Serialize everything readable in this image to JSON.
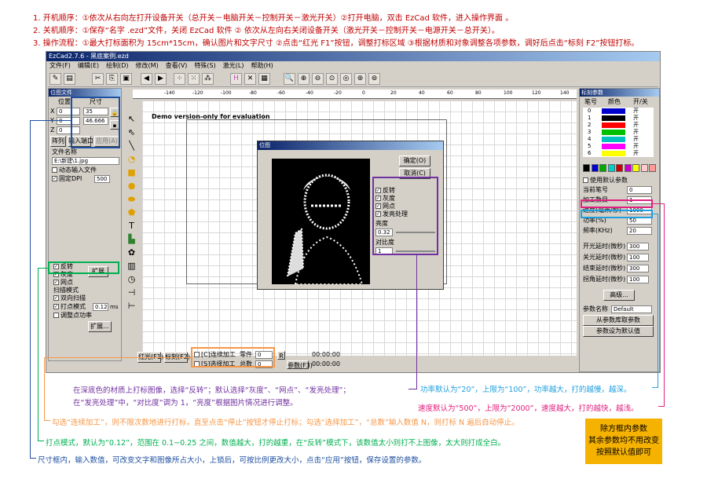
{
  "instructions": [
    "1. 开机顺序：①依次从右向左打开设备开关（总开关－电脑开关－控制开关－激光开关）②打开电脑，双击 EzCad 软件，进入操作界面 。",
    "2. 关机顺序：①保存“名字 .ezd”文件，关闭 EzCad 软件 ② 依次从左向右关闭设备开关（激光开关－控制开关－电源开关－总开关）。",
    "3. 操作流程：①最大打标面积为 15cm*15cm，确认图片和文字尺寸 ②点击“红光 F1”按钮，调整打标区域 ③根据材质和对象调整各项参数，调好后点击“标刻 F2”按钮打标。"
  ],
  "window": {
    "title": "EzCad2.7.6 - 黑底案例.ezd",
    "menus": [
      "文件(F)",
      "编辑(E)",
      "绘制(D)",
      "修改(M)",
      "查看(V)",
      "特殊(S)",
      "激光(L)",
      "帮助(H)"
    ]
  },
  "toolbar": {
    "icons": [
      "open-icon",
      "save-icon",
      "cut-icon",
      "copy-icon",
      "paste-icon",
      "zoom-in-icon",
      "zoom-out-icon"
    ]
  },
  "position_panel": {
    "title": "位图文件",
    "pos_header": "位置",
    "size_header": "尺寸",
    "x_label": "X",
    "y_label": "Y",
    "z_label": "Z",
    "x_value": "0",
    "y_value": "0",
    "z_value": "0",
    "w_value": "35",
    "h_value": "46.666",
    "tabs": [
      "阵列",
      "输入端口",
      "应用(A)"
    ]
  },
  "file_panel": {
    "name_label": "文件名称",
    "path": "E:\\新建\\1.jpg",
    "dynamic_input": "动态输入文件",
    "fixed_dpi": "固定DPI",
    "dpi_value": "500",
    "invert": "反转",
    "gray": "灰度",
    "dither": "网点",
    "expand_button": "扩展",
    "scan_mode": "扫描模式",
    "bidir": "双向扫描",
    "dot_mode": "打点模式",
    "dot_value": "0.12",
    "dot_unit": "ms",
    "adjust_power": "调整点功率",
    "expand2": "扩展..."
  },
  "ruler_marks": [
    "-140",
    "-120",
    "-100",
    "-80",
    "-60",
    "-40",
    "-20",
    "0",
    "20",
    "40",
    "60",
    "80",
    "100",
    "120",
    "140"
  ],
  "demo_text": "Demo version-only for evaluation",
  "dialog": {
    "title": "位图",
    "ok": "确定(O)",
    "cancel": "取消(C)",
    "invert": "反转",
    "gray": "灰度",
    "dither": "网点",
    "glow": "发亮处理",
    "brightness_label": "亮度",
    "brightness": "0.32",
    "contrast_label": "对比度",
    "contrast": "1"
  },
  "bottom_bar": {
    "red_light": "红光(F1)",
    "mark": "标刻(F2)",
    "continuous": "[C]连续加工",
    "part": "零件",
    "part_value": "0",
    "select_mark": "[S]选择加工",
    "total": "总数",
    "total_value": "0",
    "reset": "R",
    "param": "参数(F3)",
    "time1": "00:00:00",
    "time2": "00:00:00"
  },
  "right_panel": {
    "title": "标刻参数",
    "col1": "笔号",
    "col2": "颜色",
    "col3": "开/关",
    "pens": [
      {
        "no": "0",
        "color": "#0000cc",
        "state": "开"
      },
      {
        "no": "1",
        "color": "#000000",
        "state": "开"
      },
      {
        "no": "2",
        "color": "#ff0000",
        "state": "开"
      },
      {
        "no": "3",
        "color": "#00c000",
        "state": "开"
      },
      {
        "no": "4",
        "color": "#00c0c0",
        "state": "开"
      },
      {
        "no": "5",
        "color": "#ff00ff",
        "state": "开"
      },
      {
        "no": "6",
        "color": "#ffff00",
        "state": "开"
      }
    ],
    "use_default": "使用默认参数",
    "cur_pen": "当前笔号",
    "cur_pen_value": "0",
    "loops": "加工数目",
    "loops_value": "1",
    "speed": "速度(毫米/秒)",
    "speed_value": "1000",
    "power": "功率(%)",
    "power_value": "50",
    "freq": "频率(KHz)",
    "freq_value": "20",
    "on_delay": "开光延时(微秒)",
    "on_value": "300",
    "off_delay": "关光延时(微秒)",
    "off_value": "100",
    "end_delay": "结束延时(微秒)",
    "end_value": "300",
    "corner_delay": "拐角延时(微秒)",
    "corner_value": "100",
    "advanced": "高级...",
    "param_name": "参数名称",
    "param_name_value": "Default",
    "from_lib": "从参数库取参数",
    "set_default": "参数设为默认值"
  },
  "callouts": {
    "dark": "在深底色的材质上打标图像，选择“反转”；默认选择“灰度”、“网点”、“发亮处理”；",
    "dark2": "在“发亮处理”中，“对比度”调为 1，“亮度”根据图片情况进行调整。",
    "continuous": "勾选“连续加工”，则不限次数地进行打标，直至点击“停止”按钮才停止打标；勾选“选择加工”，“总数”输入数值 N，则打标 N 遍后自动停止。",
    "dot": "打点模式，默认为“0.12”，范围在 0.1~0.25 之间，数值越大，打的越重，在“反转”模式下，该数值太小则打不上图像，太大则打成全白。",
    "size": "尺寸框内，输入数值，可改变文字和图像所占大小，上锁后，可按比例更改大小，点击“应用”按钮，保存设置的参数。",
    "power": "功率默认为“20”，上限为“100”，功率越大，打的越慢，越深。",
    "speed": "速度默认为“500”，上限为“2000”，速度越大，打的越快，越浅。",
    "note": "除方框内参数\n其余参数均不用改变\n按照默认值即可"
  },
  "colors": {
    "purple": "#7030a0",
    "green": "#00b050",
    "orange": "#f79646",
    "blue": "#1e4fa0",
    "cyan": "#1e9fe0",
    "magenta": "#e0207f",
    "red": "#c00000"
  }
}
